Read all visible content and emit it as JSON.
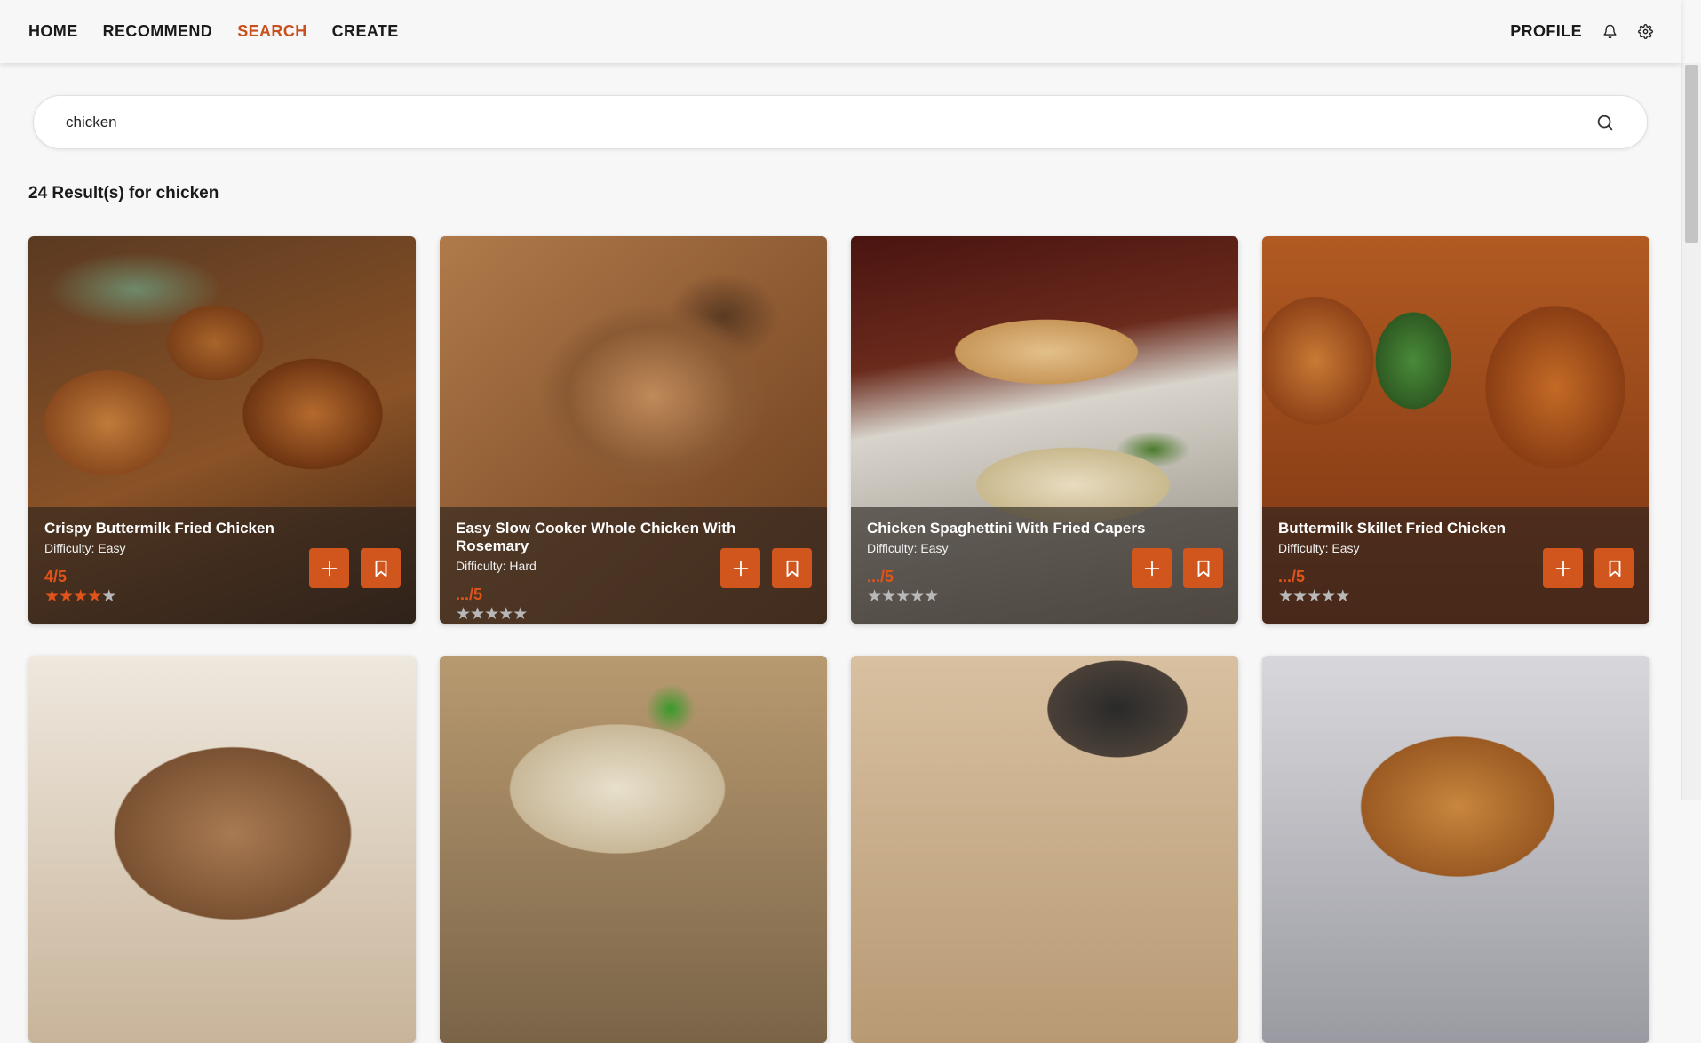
{
  "nav": {
    "links": [
      {
        "label": "HOME",
        "active": false
      },
      {
        "label": "RECOMMEND",
        "active": false
      },
      {
        "label": "SEARCH",
        "active": true
      },
      {
        "label": "CREATE",
        "active": false
      }
    ],
    "profile_label": "PROFILE",
    "icons": [
      "bell-icon",
      "gear-icon"
    ]
  },
  "search": {
    "value": "chicken",
    "icon": "search-icon"
  },
  "results": {
    "heading": "24 Result(s) for chicken"
  },
  "colors": {
    "accent": "#c8501c",
    "button": "#d0561e",
    "star_on": "#e0541c",
    "star_off": "#b8b8b8"
  },
  "recipes": [
    {
      "title": "Crispy Buttermilk Fried Chicken",
      "difficulty": "Difficulty: Easy",
      "rating_text": "4/5",
      "stars": 4,
      "theme": "fried"
    },
    {
      "title": "Easy Slow Cooker Whole Chicken With Rosemary",
      "difficulty": "Difficulty: Hard",
      "rating_text": ".../5",
      "stars": 0,
      "theme": "roast"
    },
    {
      "title": "Chicken Spaghettini With Fried Capers",
      "difficulty": "Difficulty: Easy",
      "rating_text": ".../5",
      "stars": 0,
      "theme": "pasta"
    },
    {
      "title": "Buttermilk Skillet Fried Chicken",
      "difficulty": "Difficulty: Easy",
      "rating_text": ".../5",
      "stars": 0,
      "theme": "skillet"
    },
    {
      "title": "",
      "difficulty": "",
      "rating_text": "",
      "stars": null,
      "theme": "crust"
    },
    {
      "title": "",
      "difficulty": "",
      "rating_text": "",
      "stars": null,
      "theme": "green"
    },
    {
      "title": "",
      "difficulty": "",
      "rating_text": "",
      "stars": null,
      "theme": "table"
    },
    {
      "title": "",
      "difficulty": "",
      "rating_text": "",
      "stars": null,
      "theme": "whole"
    }
  ]
}
